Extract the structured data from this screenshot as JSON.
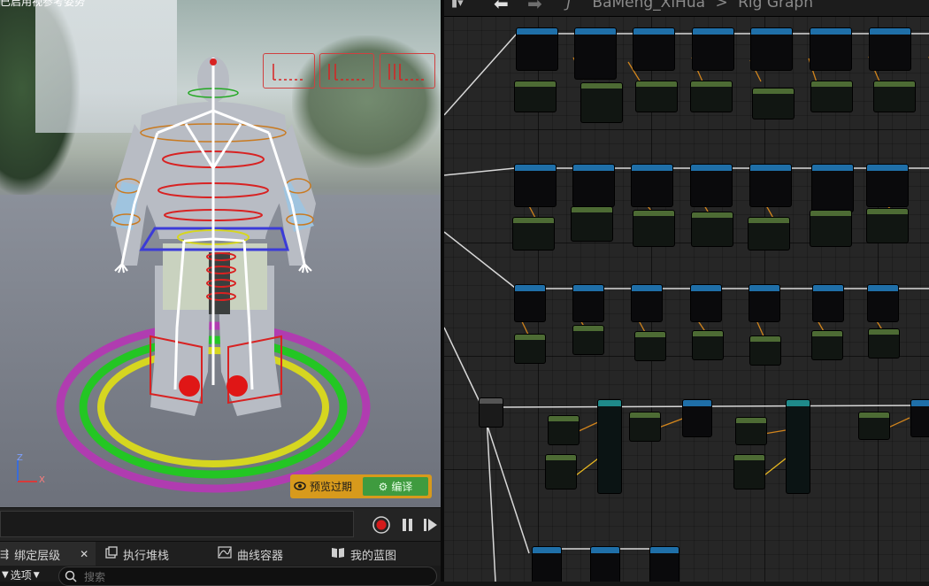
{
  "viewport": {
    "overlay_text": "已启用视参考姿势",
    "preview_label": "预览过期",
    "compile_label": "编译",
    "axis_z": "Z",
    "axis_x": "X"
  },
  "bottom_tabs": [
    {
      "label": "绑定层级",
      "icon": "hierarchy-icon",
      "closable": true
    },
    {
      "label": "执行堆栈",
      "icon": "stack-icon"
    },
    {
      "label": "曲线容器",
      "icon": "curve-icon"
    },
    {
      "label": "我的蓝图",
      "icon": "book-icon"
    }
  ],
  "toolbar": {
    "options_label": "选项",
    "search_placeholder": "搜索"
  },
  "graph": {
    "breadcrumb_asset": "BaMeng_XiHua",
    "breadcrumb_graph": "Rig Graph",
    "breadcrumb_separator": ">",
    "function_glyph": "ƒ"
  },
  "colors": {
    "record": "#d41a1a",
    "preview_bar": "#d79a1c",
    "compile": "#3f9b3f",
    "node_blue": "#1f6fa8",
    "node_green": "#4d6b34"
  }
}
